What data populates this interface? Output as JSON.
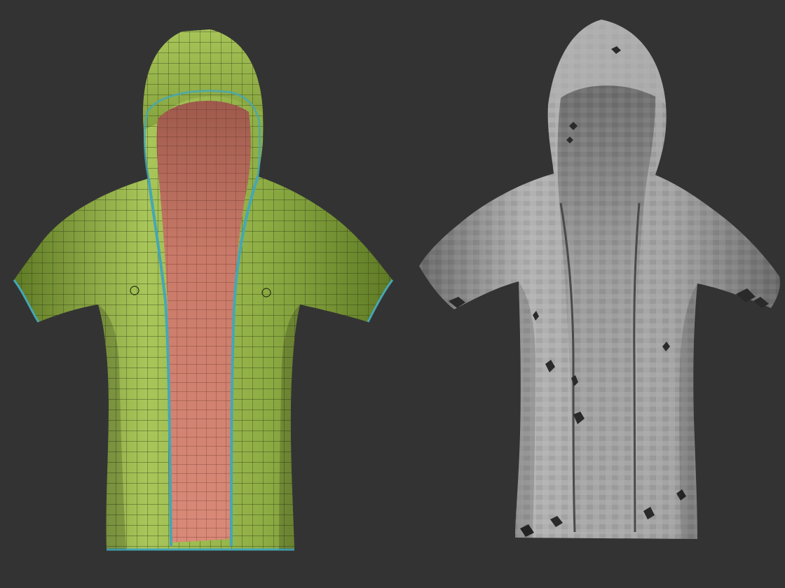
{
  "viewport": {
    "background": "#333333"
  },
  "models": [
    {
      "id": "retopo-hoodie",
      "display": "wireframe-polypaint",
      "outer_color": "#8fae45",
      "outer_color_light": "#a9c65a",
      "outer_color_dark": "#5f7a25",
      "inner_color": "#d98a78",
      "inner_color_dark": "#b6675a",
      "wire_color": "#243010",
      "edge_trim_color": "#46a7b4"
    },
    {
      "id": "sculpt-hoodie",
      "display": "matcap-gray",
      "outer_color": "#a0a0a0",
      "outer_color_light": "#b8b8b8",
      "outer_color_dark": "#6a6a6a",
      "inner_color": "#9a9a9a",
      "hole_color": "#2a2a2a"
    }
  ]
}
